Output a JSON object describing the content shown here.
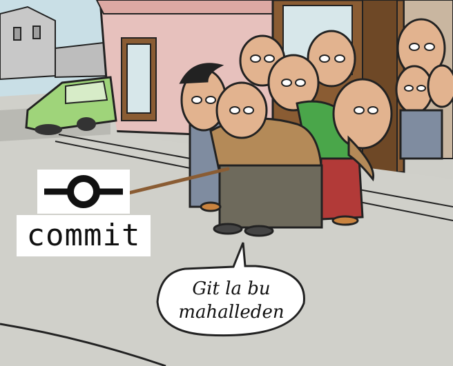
{
  "commit_badge": {
    "icon": "git-commit-icon",
    "label": "commit"
  },
  "speech_bubble": {
    "line1": "Git la bu",
    "line2": "mahalleden"
  },
  "colors": {
    "sky": "#c9dfe6",
    "wall_pink": "#e7c1bd",
    "sidewalk": "#d0d0ca",
    "car": "#9fd47a",
    "sweater_brown": "#b48a58",
    "shirt_green": "#4aa64a",
    "skirt_red": "#b23a38",
    "pants_gray": "#6e6a5c",
    "door_brown": "#8a5c33"
  }
}
